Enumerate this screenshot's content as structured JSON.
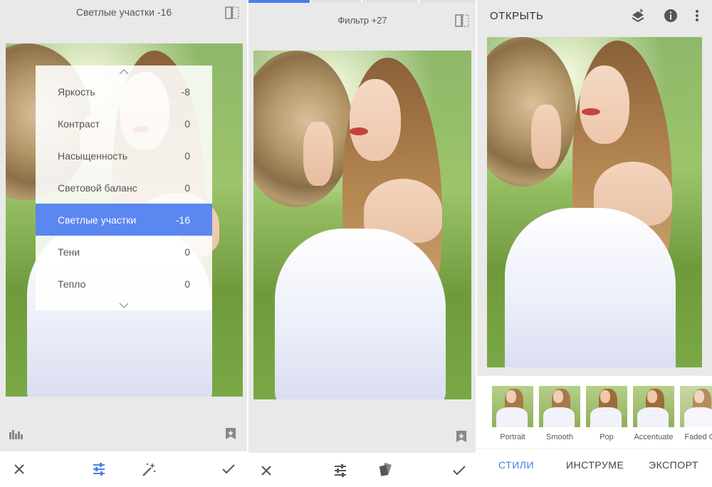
{
  "colors": {
    "accent": "#4a7ee8",
    "active_row": "#5b87f0",
    "panel_bg": "#e9e9e9",
    "icon_gray": "#777777"
  },
  "panel1": {
    "title": "Светлые участки -16",
    "menu": [
      {
        "label": "Яркость",
        "value": "-8",
        "active": false
      },
      {
        "label": "Контраст",
        "value": "0",
        "active": false
      },
      {
        "label": "Насыщенность",
        "value": "0",
        "active": false
      },
      {
        "label": "Световой баланс",
        "value": "0",
        "active": false
      },
      {
        "label": "Светлые участки",
        "value": "-16",
        "active": true
      },
      {
        "label": "Тени",
        "value": "0",
        "active": false
      },
      {
        "label": "Тепло",
        "value": "0",
        "active": false
      }
    ],
    "icons": {
      "compare": "compare-icon",
      "chevron_up": "chevron-up-icon",
      "chevron_down": "chevron-down-icon",
      "histogram": "histogram-icon",
      "styles": "bookmark-star-icon",
      "cancel": "close-icon",
      "adjust": "sliders-icon",
      "auto": "magic-wand-icon",
      "apply": "check-icon"
    }
  },
  "panel2": {
    "title": "Фильтр +27",
    "icons": {
      "compare": "compare-icon",
      "styles": "bookmark-star-icon",
      "cancel": "close-icon",
      "adjust": "sliders-icon",
      "style": "style-cards-icon",
      "apply": "check-icon"
    }
  },
  "panel3": {
    "open_label": "ОТКРЫТЬ",
    "icons": {
      "layers": "layers-icon",
      "info": "info-icon",
      "menu": "more-vert-icon"
    },
    "looks": [
      {
        "label": "Portrait"
      },
      {
        "label": "Smooth"
      },
      {
        "label": "Pop"
      },
      {
        "label": "Accentuate"
      },
      {
        "label": "Faded Gl"
      }
    ],
    "tabs": [
      {
        "label": "СТИЛИ",
        "active": true
      },
      {
        "label": "ИНСТРУМЕ",
        "active": false
      },
      {
        "label": "ЭКСПОРТ",
        "active": false
      }
    ]
  }
}
